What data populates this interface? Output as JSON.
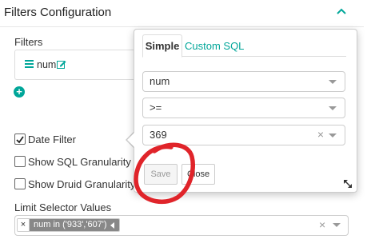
{
  "section": {
    "title": "Filters Configuration"
  },
  "filters": {
    "label": "Filters",
    "pill": {
      "text": "num"
    }
  },
  "checkboxes": [
    {
      "label": "Date Filter",
      "checked": true
    },
    {
      "label": "Show SQL Granularity D",
      "checked": false
    },
    {
      "label": "Show Druid Granularity D",
      "checked": false
    }
  ],
  "limit_selector": {
    "label": "Limit Selector Values",
    "tag": {
      "remove": "×",
      "value": "num in ('933','607')"
    },
    "clear": "×"
  },
  "popover": {
    "tabs": [
      {
        "label": "Simple",
        "active": true
      },
      {
        "label": "Custom SQL",
        "active": false
      }
    ],
    "column": {
      "value": "num"
    },
    "operator": {
      "value": ">="
    },
    "comparator": {
      "value": "369",
      "clear": "×"
    },
    "save_label": "Save",
    "close_label": "Close"
  },
  "colors": {
    "accent": "#00a699",
    "annotation": "#e0242a"
  }
}
